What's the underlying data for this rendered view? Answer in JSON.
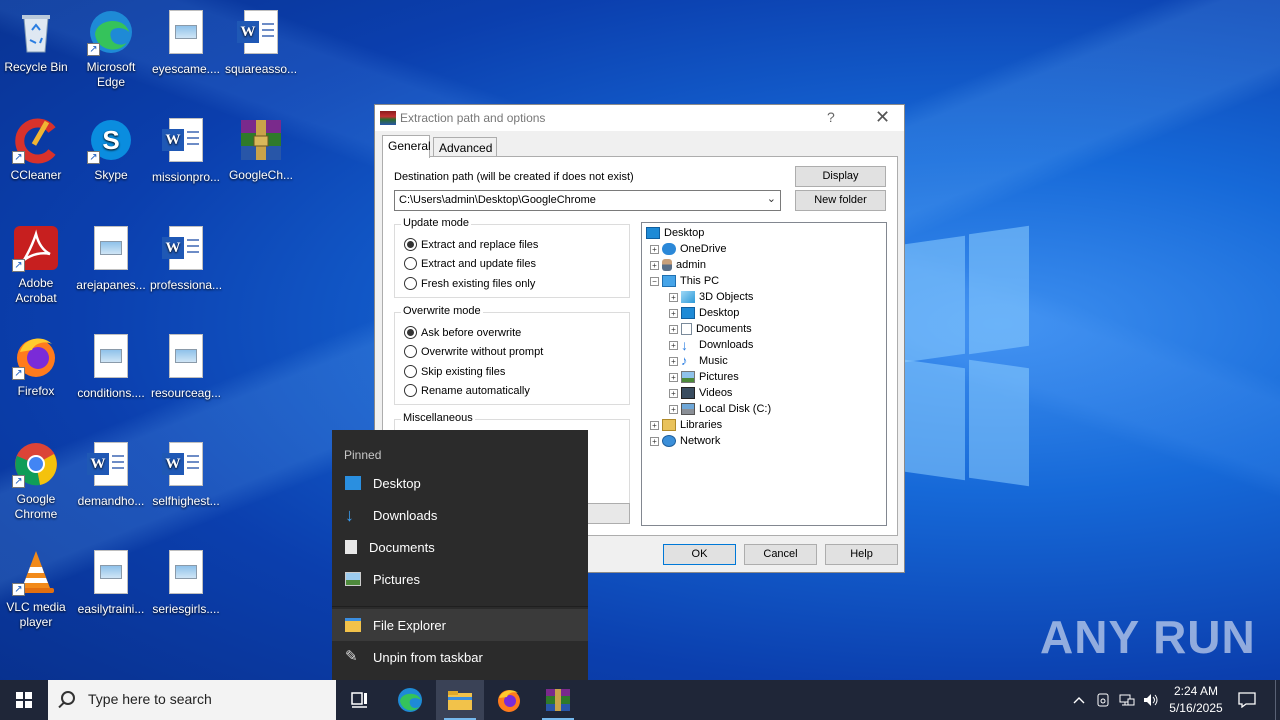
{
  "desktop": {
    "icons": [
      {
        "label": "Recycle Bin"
      },
      {
        "label": "Microsoft Edge"
      },
      {
        "label": "eyescame...."
      },
      {
        "label": "squareasso..."
      },
      {
        "label": "CCleaner"
      },
      {
        "label": "Skype"
      },
      {
        "label": "missionpro..."
      },
      {
        "label": "GoogleCh..."
      },
      {
        "label": "Adobe Acrobat"
      },
      {
        "label": "arejapanes..."
      },
      {
        "label": "professiona..."
      },
      {
        "label": "Firefox"
      },
      {
        "label": "conditions...."
      },
      {
        "label": "resourceag..."
      },
      {
        "label": "Google Chrome"
      },
      {
        "label": "demandho..."
      },
      {
        "label": "selfhighest..."
      },
      {
        "label": "VLC media player"
      },
      {
        "label": "easilytraini..."
      },
      {
        "label": "seriesgirls...."
      }
    ],
    "watermark": "ANY RUN"
  },
  "dialog": {
    "title": "Extraction path and options",
    "help_glyph": "?",
    "close_glyph": "✕",
    "tabs": [
      {
        "label": "General"
      },
      {
        "label": "Advanced"
      }
    ],
    "dest_label": "Destination path (will be created if does not exist)",
    "dest_value": "C:\\Users\\admin\\Desktop\\GoogleChrome",
    "display_btn": "Display",
    "new_folder_btn": "New folder",
    "update_mode": {
      "title": "Update mode",
      "options": [
        "Extract and replace files",
        "Extract and update files",
        "Fresh existing files only"
      ],
      "selected": 0
    },
    "overwrite_mode": {
      "title": "Overwrite mode",
      "options": [
        "Ask before overwrite",
        "Overwrite without prompt",
        "Skip existing files",
        "Rename automatically"
      ],
      "selected": 0
    },
    "misc_title": "Miscellaneous",
    "tree": [
      {
        "label": "Desktop",
        "icon": "desktop-icon",
        "expander": ""
      },
      {
        "label": "OneDrive",
        "icon": "onedrive-icon",
        "expander": "+"
      },
      {
        "label": "admin",
        "icon": "user-icon",
        "expander": "+"
      },
      {
        "label": "This PC",
        "icon": "pc-icon",
        "expander": "−"
      },
      {
        "label": "3D Objects",
        "icon": "3d-objects-icon",
        "expander": "+"
      },
      {
        "label": "Desktop",
        "icon": "desktop-icon",
        "expander": "+"
      },
      {
        "label": "Documents",
        "icon": "documents-icon",
        "expander": "+"
      },
      {
        "label": "Downloads",
        "icon": "downloads-icon",
        "expander": "+"
      },
      {
        "label": "Music",
        "icon": "music-icon",
        "expander": "+"
      },
      {
        "label": "Pictures",
        "icon": "pictures-icon",
        "expander": "+"
      },
      {
        "label": "Videos",
        "icon": "videos-icon",
        "expander": "+"
      },
      {
        "label": "Local Disk (C:)",
        "icon": "drive-icon",
        "expander": "+"
      },
      {
        "label": "Libraries",
        "icon": "libraries-icon",
        "expander": "+"
      },
      {
        "label": "Network",
        "icon": "network-icon",
        "expander": "+"
      }
    ],
    "ok_btn": "OK",
    "cancel_btn": "Cancel",
    "help_btn": "Help"
  },
  "jumplist": {
    "header": "Pinned",
    "pinned": [
      {
        "label": "Desktop",
        "icon": "desktop-icon"
      },
      {
        "label": "Downloads",
        "icon": "downloads-icon"
      },
      {
        "label": "Documents",
        "icon": "documents-icon"
      },
      {
        "label": "Pictures",
        "icon": "pictures-icon"
      }
    ],
    "app": "File Explorer",
    "unpin": "Unpin from taskbar"
  },
  "taskbar": {
    "search_placeholder": "Type here to search",
    "time": "2:24 AM",
    "date": "5/16/2025"
  },
  "colors": {
    "accent": "#0078d7",
    "taskbar": "#1f2638",
    "jumplist": "#2b2b2b"
  }
}
